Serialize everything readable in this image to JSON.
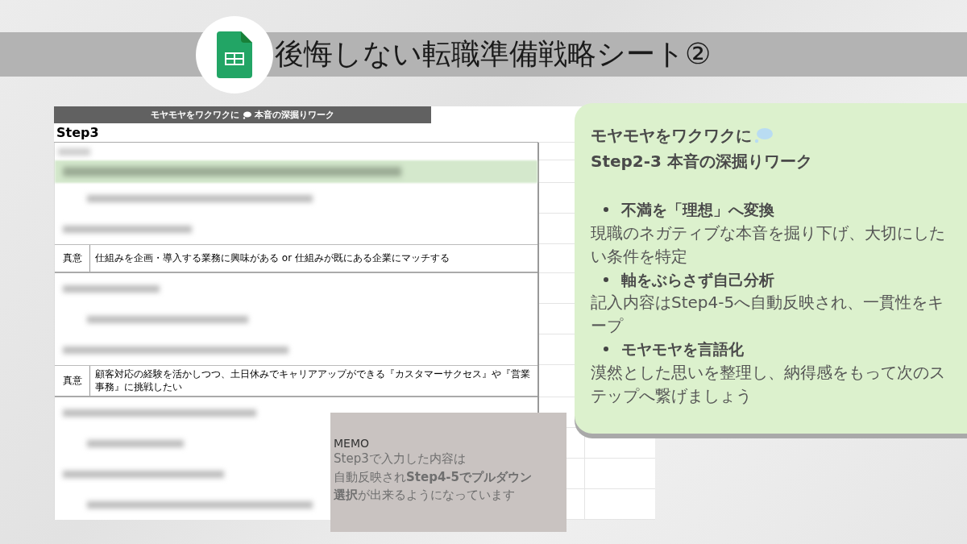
{
  "slide": {
    "title": "後悔しない転職準備戦略シート②"
  },
  "sheet": {
    "header": [
      "モヤモヤをワクワクに",
      "本音の深掘りワーク"
    ],
    "step": "Step3",
    "rows": [
      {
        "kind": "label"
      },
      {
        "kind": "band"
      },
      {
        "kind": "blurred"
      },
      {
        "kind": "blurred"
      },
      {
        "kind": "answer",
        "label": "真意",
        "text": "仕組みを企画・導入する業務に興味がある or 仕組みが既にある企業にマッチする"
      },
      {
        "kind": "blurred"
      },
      {
        "kind": "blurred"
      },
      {
        "kind": "blurred"
      },
      {
        "kind": "answer",
        "label": "真意",
        "text": "顧客対応の経験を活かしつつ、土日休みでキャリアアップができる『カスタマーサクセス』や『営業事務』に挑戦したい"
      },
      {
        "kind": "blurred"
      },
      {
        "kind": "blurred"
      },
      {
        "kind": "blurred"
      },
      {
        "kind": "blurred"
      }
    ]
  },
  "memo": {
    "title": "MEMO",
    "lines": [
      "Step3で入力した内容は",
      "自動反映され**Step4-5でプルダウン**",
      "**選択**が出来るようになっています"
    ]
  },
  "card": {
    "title": [
      "モヤモヤをワクワクに",
      "Step2-3 本音の深掘りワーク"
    ],
    "points": [
      {
        "heading": "不満を「理想」へ変換",
        "text": "現職のネガティブな本音を掘り下げ、大切にしたい条件を特定"
      },
      {
        "heading": "軸をぶらさず自己分析",
        "text": "記入内容はStep4-5へ自動反映され、一貫性をキープ"
      },
      {
        "heading": "モヤモヤを言語化",
        "text": "漠然とした思いを整理し、納得感をもって次のステップへ繋げましょう"
      }
    ]
  }
}
